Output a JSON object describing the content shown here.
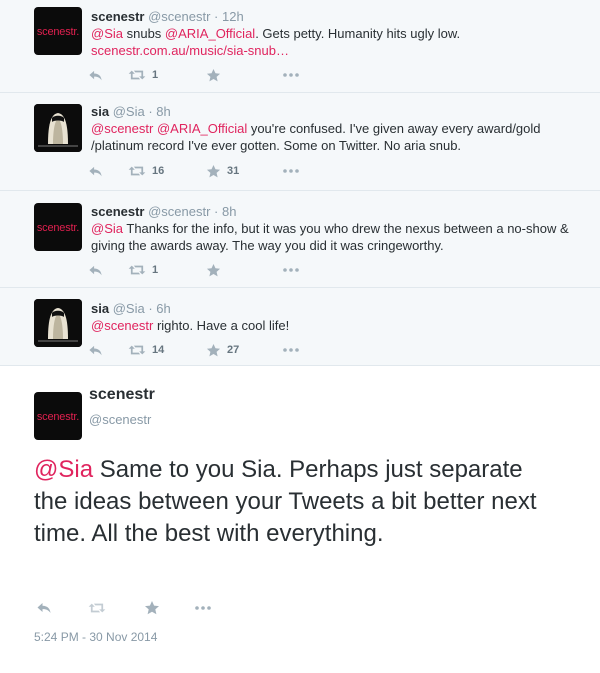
{
  "tweets": [
    {
      "avatar": "scenestr-logo",
      "avatar_text": "scenestr.",
      "name": "scenestr",
      "handle": "@scenestr",
      "time": " · 12h",
      "text_pre": "",
      "mention1": "@Sia",
      "text_mid": " snubs ",
      "mention2": "@ARIA_Official",
      "text_post": ". Gets petty. Humanity hits ugly low.",
      "link": "scenestr.com.au/music/sia-snub…",
      "retweets": "1",
      "favorites": ""
    },
    {
      "avatar": "sia-photo",
      "name": "sia",
      "handle": "@Sia",
      "time": " · 8h",
      "mention1": "@scenestr",
      "text_mid": " ",
      "mention2": "@ARIA_Official",
      "text_post": " you're confused. I've given away every award/gold /platinum record I've ever gotten. Some on Twitter. No aria snub.",
      "retweets": "16",
      "favorites": "31"
    },
    {
      "avatar": "scenestr-logo",
      "avatar_text": "scenestr.",
      "name": "scenestr",
      "handle": "@scenestr",
      "time": " · 8h",
      "mention1": "@Sia",
      "text_post": " Thanks for the info, but it was you who drew the nexus between a no-show & giving the awards away. The way you did it was cringeworthy.",
      "retweets": "1",
      "favorites": ""
    },
    {
      "avatar": "sia-photo",
      "name": "sia",
      "handle": "@Sia",
      "time": " · 6h",
      "mention1": "@scenestr",
      "text_post": " righto. Have a cool life!",
      "retweets": "14",
      "favorites": "27"
    }
  ],
  "highlight": {
    "avatar_text": "scenestr.",
    "name": "scenestr",
    "handle": "@scenestr",
    "mention": "@Sia",
    "text": " Same to you Sia. Perhaps just separate the ideas between your Tweets a bit better next time. All the best with everything.",
    "timestamp": "5:24 PM - 30 Nov 2014"
  },
  "icons": [
    "reply-icon",
    "retweet-icon",
    "favorite-icon",
    "more-icon"
  ],
  "colors": {
    "mention": "#e0245e",
    "meta": "#8899a6",
    "background": "#f5f8fa",
    "logo": "#e0204f"
  }
}
